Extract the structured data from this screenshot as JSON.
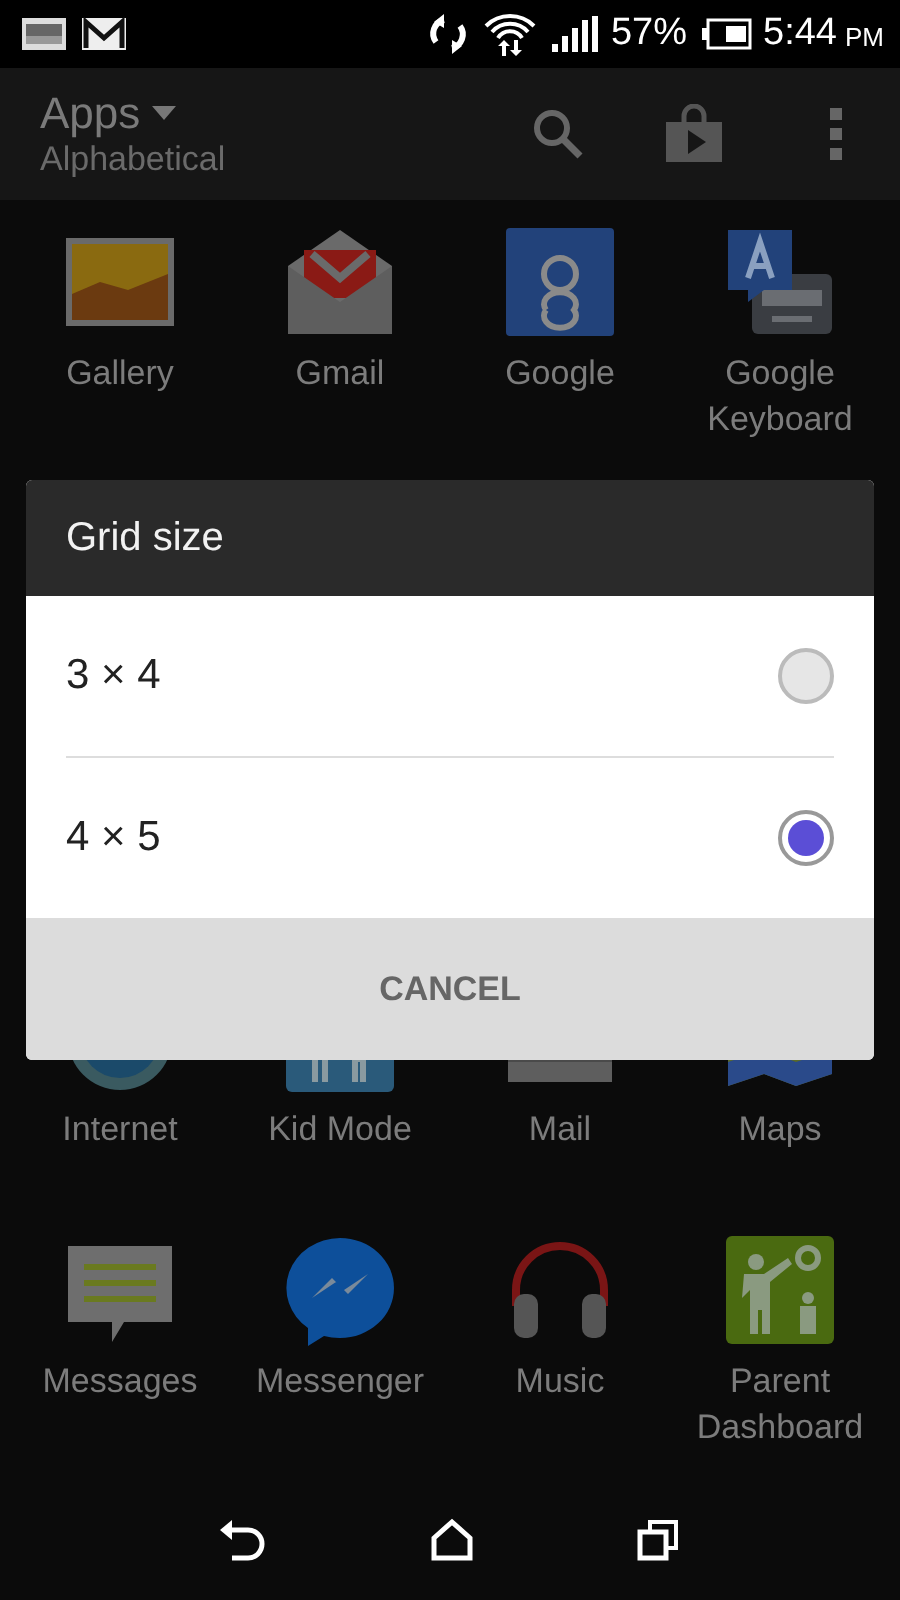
{
  "status_bar": {
    "battery": "57%",
    "time": "5:44",
    "ampm": "PM"
  },
  "app_bar": {
    "title": "Apps",
    "subtitle": "Alphabetical"
  },
  "apps_above_dialog": [
    {
      "label": "Gallery"
    },
    {
      "label": "Gmail"
    },
    {
      "label": "Google"
    },
    {
      "label": "Google Keyboard"
    }
  ],
  "apps_below_dialog": [
    {
      "label": "Internet"
    },
    {
      "label": "Kid Mode"
    },
    {
      "label": "Mail"
    },
    {
      "label": "Maps"
    },
    {
      "label": "Messages"
    },
    {
      "label": "Messenger"
    },
    {
      "label": "Music"
    },
    {
      "label": "Parent Dashboard"
    }
  ],
  "dialog": {
    "title": "Grid size",
    "options": [
      {
        "label": "3 × 4",
        "selected": false
      },
      {
        "label": "4 × 5",
        "selected": true
      }
    ],
    "buttons": [
      "CANCEL"
    ]
  }
}
